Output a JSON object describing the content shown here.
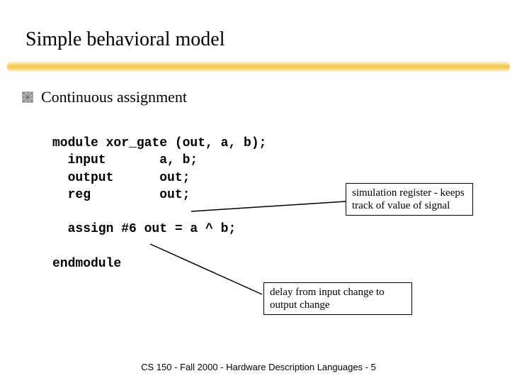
{
  "title": "Simple behavioral model",
  "bullet": {
    "icon_name": "bullet-square-icon",
    "text": "Continuous assignment"
  },
  "code": {
    "l1": "module xor_gate (out, a, b);",
    "l2": "  input       a, b;",
    "l3": "  output      out;",
    "l4": "  reg         out;",
    "l5": "",
    "l6": "  assign #6 out = a ^ b;",
    "l7": "",
    "l8": "endmodule"
  },
  "annotations": {
    "sim_register": "simulation register - keeps track of value of signal",
    "delay": "delay from input change to output change"
  },
  "footer": "CS 150 - Fall 2000 - Hardware Description Languages - 5",
  "colors": {
    "highlight": "#f6c43c"
  }
}
